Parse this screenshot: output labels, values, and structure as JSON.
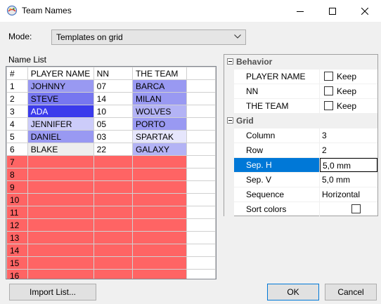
{
  "window": {
    "title": "Team Names"
  },
  "mode": {
    "label": "Mode:",
    "value": "Templates on grid"
  },
  "name_list": {
    "label": "Name List",
    "columns": [
      "#",
      "PLAYER NAME",
      "NN",
      "THE TEAM"
    ],
    "rows": [
      {
        "num": "1",
        "name": "JOHNNY",
        "nn": "07",
        "team": "BARCA",
        "name_color": "#9999f2",
        "team_color": "#9999f2"
      },
      {
        "num": "2",
        "name": "STEVE",
        "nn": "14",
        "team": "MILAN",
        "name_color": "#7777f0",
        "team_color": "#9999f2"
      },
      {
        "num": "3",
        "name": "ADA",
        "nn": "10",
        "team": "WOLVES",
        "name_color": "#3b3bec",
        "team_color": "#b3b3f5"
      },
      {
        "num": "4",
        "name": "JENNIFER",
        "nn": "05",
        "team": "PORTO",
        "name_color": "#ccccfa",
        "team_color": "#9999f2"
      },
      {
        "num": "5",
        "name": "DANIEL",
        "nn": "03",
        "team": "SPARTAK",
        "name_color": "#9999f2",
        "team_color": "#e6e6fc"
      },
      {
        "num": "6",
        "name": "BLAKE",
        "nn": "22",
        "team": "GALAXY",
        "name_color": "#eeeeee",
        "team_color": "#b3b3f5"
      }
    ],
    "empty_rows": [
      "7",
      "8",
      "9",
      "10",
      "11",
      "12",
      "13",
      "14",
      "15",
      "16"
    ],
    "empty_color": "#ff6464"
  },
  "behavior": {
    "label": "Behavior",
    "rows": [
      {
        "name": "PLAYER NAME",
        "value": "Keep",
        "checked": false
      },
      {
        "name": "NN",
        "value": "Keep",
        "checked": false
      },
      {
        "name": "THE TEAM",
        "value": "Keep",
        "checked": false
      }
    ]
  },
  "grid": {
    "label": "Grid",
    "rows": [
      {
        "name": "Column",
        "value": "3"
      },
      {
        "name": "Row",
        "value": "2"
      },
      {
        "name": "Sep. H",
        "value": "5,0 mm",
        "selected": true
      },
      {
        "name": "Sep. V",
        "value": "5,0 mm"
      },
      {
        "name": "Sequence",
        "value": "Horizontal"
      },
      {
        "name": "Sort colors",
        "value": "",
        "checkbox": true,
        "checked": false
      }
    ]
  },
  "buttons": {
    "import": "Import List...",
    "ok": "OK",
    "cancel": "Cancel"
  },
  "colors": {
    "selection": "#0078d7",
    "accent_blue": "#3b3bec"
  }
}
